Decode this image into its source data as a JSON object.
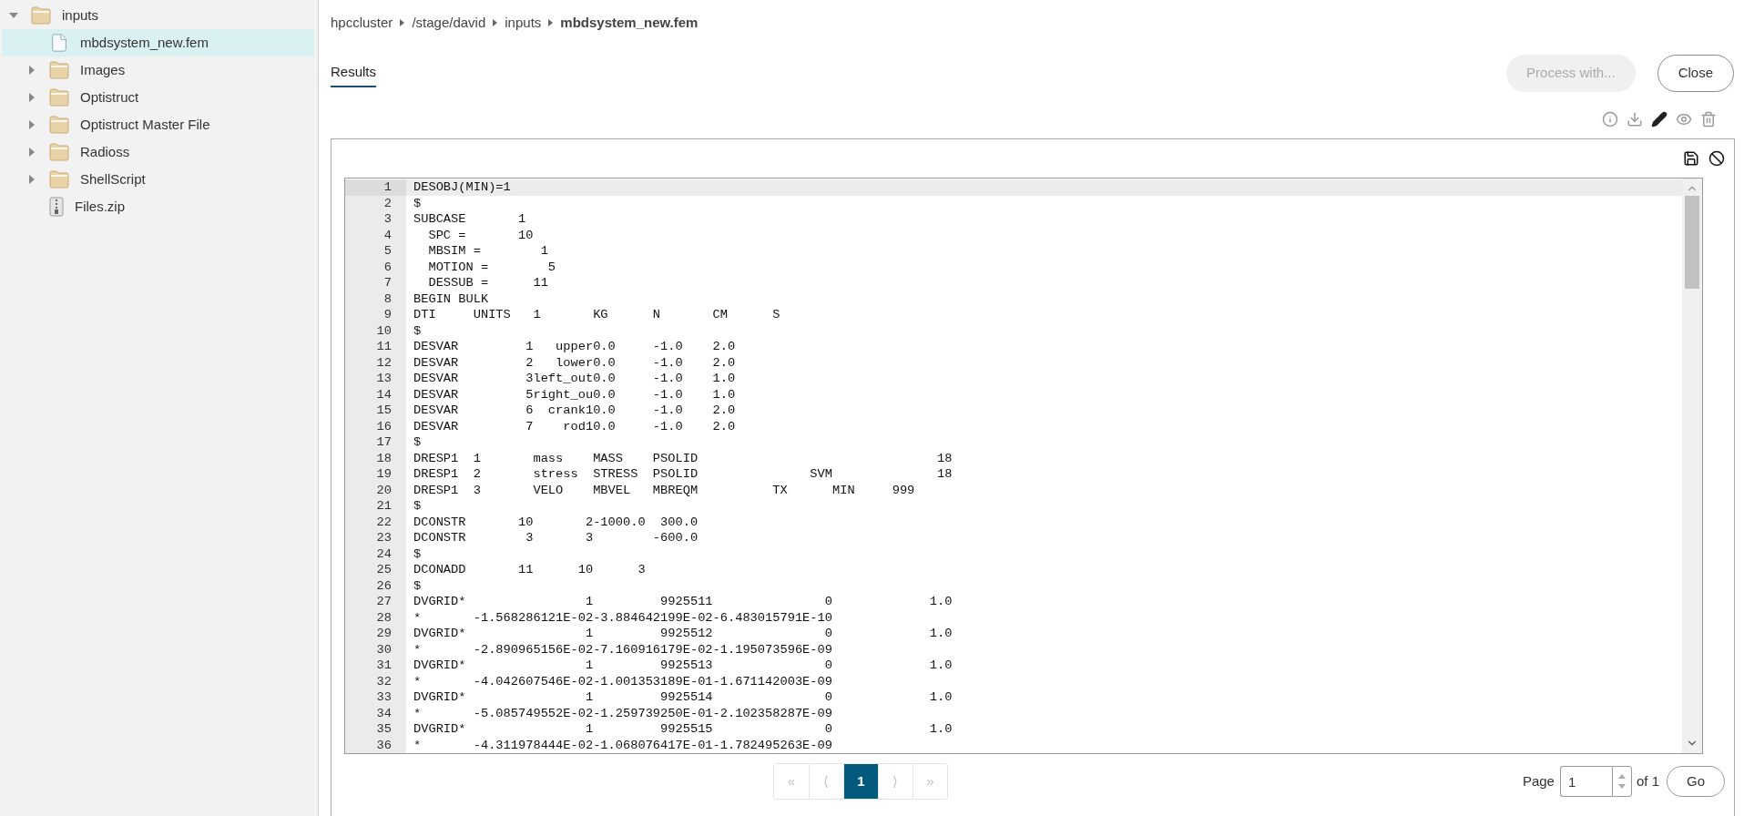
{
  "sidebar": {
    "tree": [
      {
        "label": "inputs",
        "kind": "folder",
        "expanded": true,
        "selected": false,
        "children": [
          {
            "label": "mbdsystem_new.fem",
            "kind": "file",
            "selected": true
          },
          {
            "label": "Images",
            "kind": "folder",
            "expanded": false,
            "selected": false
          },
          {
            "label": "Optistruct",
            "kind": "folder",
            "expanded": false,
            "selected": false
          },
          {
            "label": "Optistruct Master File",
            "kind": "folder",
            "expanded": false,
            "selected": false
          },
          {
            "label": "Radioss",
            "kind": "folder",
            "expanded": false,
            "selected": false
          },
          {
            "label": "ShellScript",
            "kind": "folder",
            "expanded": false,
            "selected": false
          },
          {
            "label": "Files.zip",
            "kind": "zip",
            "selected": false
          }
        ]
      }
    ]
  },
  "breadcrumb": [
    "hpccluster",
    "/stage/david",
    "inputs",
    "mbdsystem_new.fem"
  ],
  "tabs": [
    {
      "label": "Results",
      "selected": true
    }
  ],
  "actions": [
    {
      "label": "Process with...",
      "disabled": true
    },
    {
      "label": "Close",
      "disabled": false
    }
  ],
  "editor": {
    "lines": [
      {
        "number": "1",
        "text": "DESOBJ(MIN)=1",
        "highlighted": true
      },
      {
        "number": "2",
        "text": "$",
        "highlighted": false
      },
      {
        "number": "3",
        "text": "SUBCASE       1",
        "highlighted": false
      },
      {
        "number": "4",
        "text": "  SPC =       10",
        "highlighted": false
      },
      {
        "number": "5",
        "text": "  MBSIM =        1",
        "highlighted": false
      },
      {
        "number": "6",
        "text": "  MOTION =        5",
        "highlighted": false
      },
      {
        "number": "7",
        "text": "  DESSUB =      11",
        "highlighted": false
      },
      {
        "number": "8",
        "text": "BEGIN BULK",
        "highlighted": false
      },
      {
        "number": "9",
        "text": "DTI     UNITS   1       KG      N       CM      S",
        "highlighted": false
      },
      {
        "number": "10",
        "text": "$",
        "highlighted": false
      },
      {
        "number": "11",
        "text": "DESVAR         1   upper0.0     -1.0    2.0",
        "highlighted": false
      },
      {
        "number": "12",
        "text": "DESVAR         2   lower0.0     -1.0    2.0",
        "highlighted": false
      },
      {
        "number": "13",
        "text": "DESVAR         3left_out0.0     -1.0    1.0",
        "highlighted": false
      },
      {
        "number": "14",
        "text": "DESVAR         5right_ou0.0     -1.0    1.0",
        "highlighted": false
      },
      {
        "number": "15",
        "text": "DESVAR         6  crank10.0     -1.0    2.0",
        "highlighted": false
      },
      {
        "number": "16",
        "text": "DESVAR         7    rod10.0     -1.0    2.0",
        "highlighted": false
      },
      {
        "number": "17",
        "text": "$",
        "highlighted": false
      },
      {
        "number": "18",
        "text": "DRESP1  1       mass    MASS    PSOLID                                18",
        "highlighted": false
      },
      {
        "number": "19",
        "text": "DRESP1  2       stress  STRESS  PSOLID               SVM              18",
        "highlighted": false
      },
      {
        "number": "20",
        "text": "DRESP1  3       VELO    MBVEL   MBREQM          TX      MIN     999",
        "highlighted": false
      },
      {
        "number": "21",
        "text": "$",
        "highlighted": false
      },
      {
        "number": "22",
        "text": "DCONSTR       10       2-1000.0  300.0",
        "highlighted": false
      },
      {
        "number": "23",
        "text": "DCONSTR        3       3        -600.0",
        "highlighted": false
      },
      {
        "number": "24",
        "text": "$",
        "highlighted": false
      },
      {
        "number": "25",
        "text": "DCONADD       11      10      3",
        "highlighted": false
      },
      {
        "number": "26",
        "text": "$",
        "highlighted": false
      },
      {
        "number": "27",
        "text": "DVGRID*                1         9925511               0             1.0",
        "highlighted": false
      },
      {
        "number": "28",
        "text": "*       -1.568286121E-02-3.884642199E-02-6.483015791E-10",
        "highlighted": false
      },
      {
        "number": "29",
        "text": "DVGRID*                1         9925512               0             1.0",
        "highlighted": false
      },
      {
        "number": "30",
        "text": "*       -2.890965156E-02-7.160916179E-02-1.195073596E-09",
        "highlighted": false
      },
      {
        "number": "31",
        "text": "DVGRID*                1         9925513               0             1.0",
        "highlighted": false
      },
      {
        "number": "32",
        "text": "*       -4.042607546E-02-1.001353189E-01-1.671142003E-09",
        "highlighted": false
      },
      {
        "number": "33",
        "text": "DVGRID*                1         9925514               0             1.0",
        "highlighted": false
      },
      {
        "number": "34",
        "text": "*       -5.085749552E-02-1.259739250E-01-2.102358287E-09",
        "highlighted": false
      },
      {
        "number": "35",
        "text": "DVGRID*                1         9925515               0             1.0",
        "highlighted": false
      },
      {
        "number": "36",
        "text": "*       -4.311978444E-02-1.068076417E-01-1.782495263E-09",
        "highlighted": false
      }
    ]
  },
  "pagination": {
    "buttons": [
      {
        "label": "«",
        "selected": false,
        "disabled": true
      },
      {
        "label": "⟨",
        "selected": false,
        "disabled": true
      },
      {
        "label": "1",
        "selected": true,
        "disabled": false
      },
      {
        "label": "⟩",
        "selected": false,
        "disabled": true
      },
      {
        "label": "»",
        "selected": false,
        "disabled": true
      }
    ],
    "page_label": "Page",
    "page_value": "1",
    "page_total": "of 1",
    "go": "Go"
  }
}
